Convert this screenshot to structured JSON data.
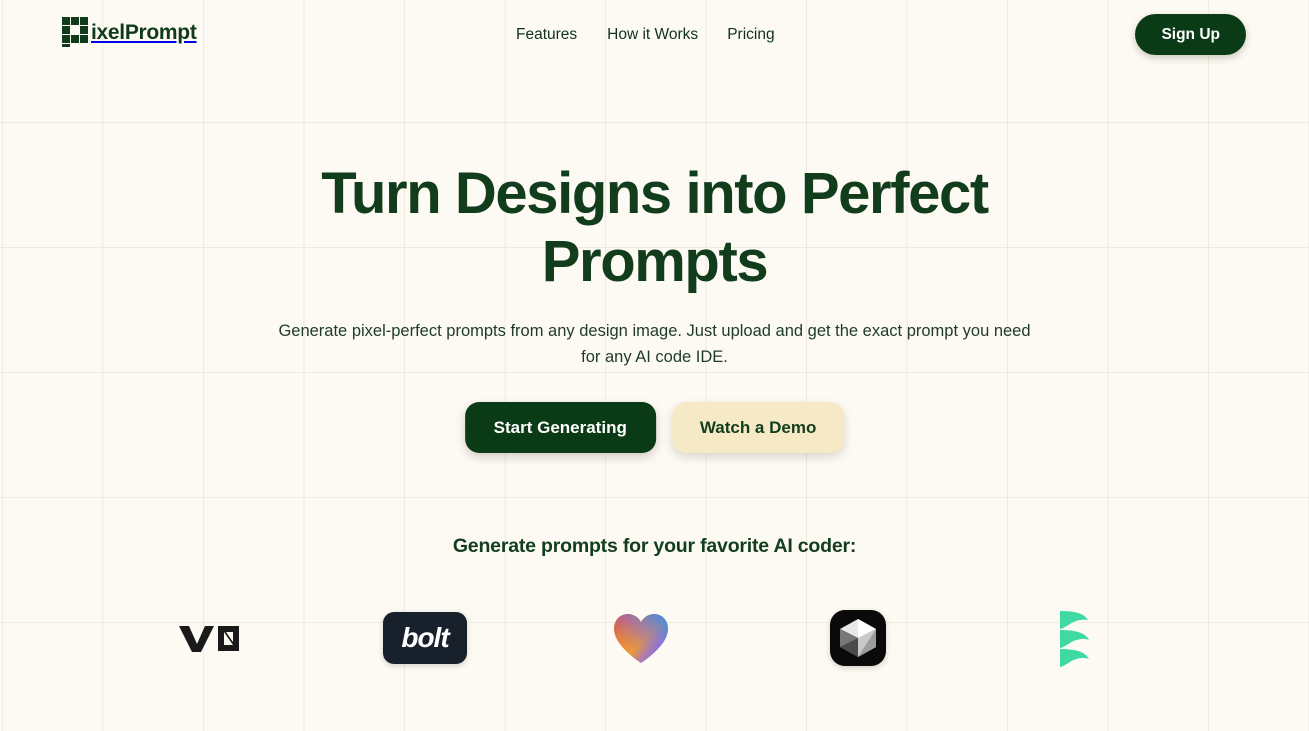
{
  "brand": {
    "logo_icon": "pixel-p-icon",
    "name": "ixelPrompt",
    "full_name": "PixelPrompt"
  },
  "colors": {
    "background": "#fdfaf3",
    "primary_dark_green": "#0b3a16",
    "heading_green": "#113d1c",
    "cream_button": "#f6e9c6",
    "grid_line": "#d0c4b0"
  },
  "header": {
    "nav": [
      {
        "label": "Features"
      },
      {
        "label": "How it Works"
      },
      {
        "label": "Pricing"
      }
    ],
    "signup_label": "Sign Up"
  },
  "hero": {
    "headline": "Turn Designs into Perfect Prompts",
    "subtitle": "Generate pixel-perfect prompts from any design image. Just upload and get the exact prompt you need for any AI code IDE.",
    "primary_cta": "Start Generating",
    "secondary_cta": "Watch a Demo"
  },
  "logos_section": {
    "heading": "Generate prompts for your favorite AI coder:",
    "brands": [
      {
        "name": "v0",
        "icon": "v0-logo-icon"
      },
      {
        "name": "bolt",
        "icon": "bolt-logo-icon",
        "label": "bolt"
      },
      {
        "name": "Lovable",
        "icon": "lovable-heart-icon"
      },
      {
        "name": "Cursor",
        "icon": "cursor-cube-icon"
      },
      {
        "name": "Windsurf",
        "icon": "windsurf-waves-icon"
      }
    ]
  }
}
